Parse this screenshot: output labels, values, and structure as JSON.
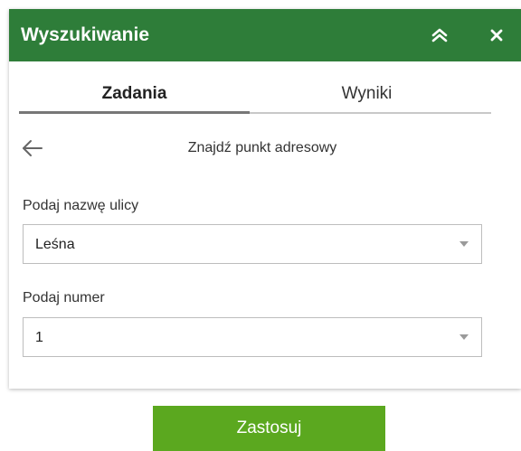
{
  "header": {
    "title": "Wyszukiwanie",
    "collapse_icon": "double-chevron-up-icon",
    "close_icon": "close-icon"
  },
  "tabs": [
    {
      "label": "Zadania",
      "active": true
    },
    {
      "label": "Wyniki",
      "active": false
    }
  ],
  "task": {
    "back_icon": "arrow-left-icon",
    "title": "Znajdź punkt adresowy"
  },
  "form": {
    "street": {
      "label": "Podaj nazwę ulicy",
      "value": "Leśna"
    },
    "number": {
      "label": "Podaj numer",
      "value": "1"
    }
  },
  "apply_label": "Zastosuj",
  "colors": {
    "header_bg": "#2e7d39",
    "apply_bg": "#5ba81f"
  }
}
